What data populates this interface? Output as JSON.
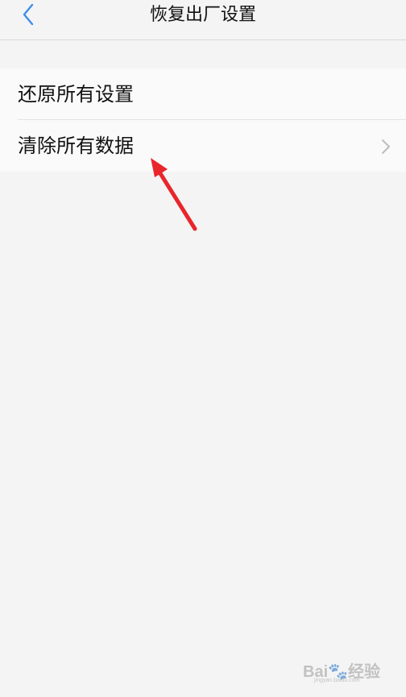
{
  "header": {
    "title": "恢复出厂设置",
    "back_icon": "chevron-left-icon",
    "accent_color": "#3f8ee8"
  },
  "list": {
    "items": [
      {
        "label": "还原所有设置",
        "has_chevron": false
      },
      {
        "label": "清除所有数据",
        "has_chevron": true
      }
    ]
  },
  "annotation": {
    "type": "red-arrow",
    "color": "#e8262b",
    "target": "清除所有数据"
  },
  "watermark": {
    "brand": "Bai",
    "brand_suffix": "经验",
    "url": "jingyan.baidu.com"
  }
}
